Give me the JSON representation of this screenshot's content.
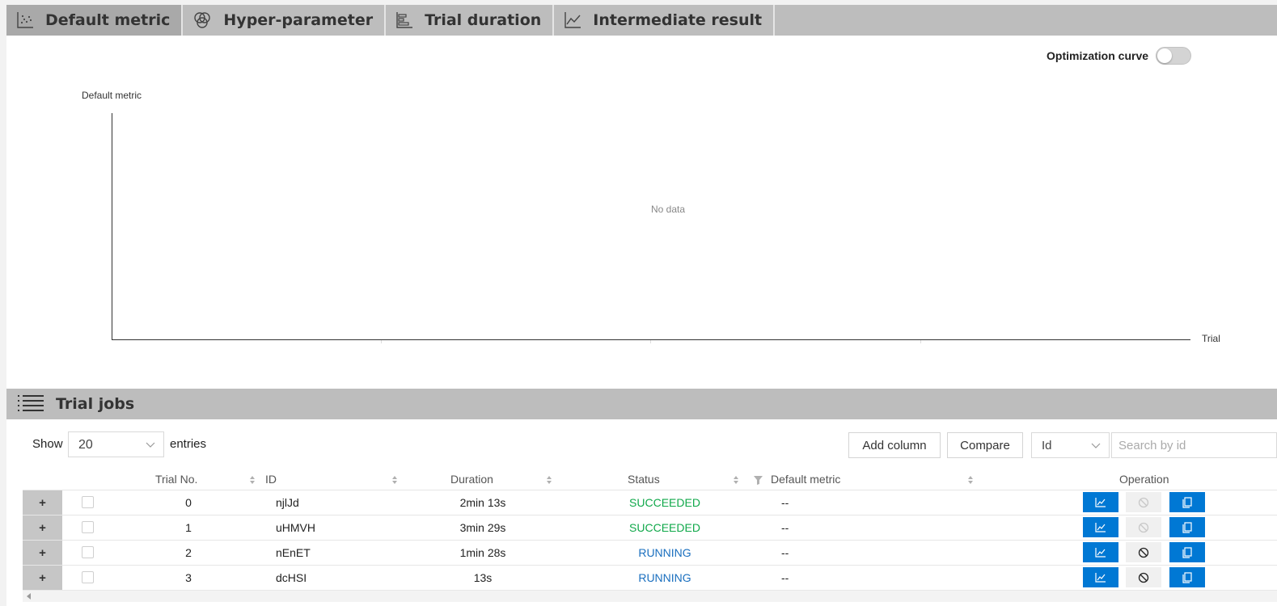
{
  "tabs": [
    {
      "label": "Default metric",
      "icon": "scatter-chart-icon",
      "active": true
    },
    {
      "label": "Hyper-parameter",
      "icon": "venn-diagram-icon",
      "active": false
    },
    {
      "label": "Trial duration",
      "icon": "bar-chart-icon",
      "active": false
    },
    {
      "label": "Intermediate result",
      "icon": "line-chart-icon",
      "active": false
    }
  ],
  "chart": {
    "optimization_curve_label": "Optimization curve",
    "optimization_curve_on": false,
    "ylabel": "Default metric",
    "xlabel": "Trial",
    "empty_text": "No data"
  },
  "chart_data": {
    "type": "scatter",
    "title": "",
    "xlabel": "Trial",
    "ylabel": "Default metric",
    "series": [],
    "note": "No data"
  },
  "jobs": {
    "title": "Trial jobs",
    "show_label": "Show",
    "entries_value": "20",
    "entries_label": "entries",
    "add_column_label": "Add column",
    "compare_label": "Compare",
    "search_field_value": "Id",
    "search_placeholder": "Search by id",
    "columns": {
      "trial_no": "Trial No.",
      "id": "ID",
      "duration": "Duration",
      "status": "Status",
      "default_metric": "Default metric",
      "operation": "Operation"
    },
    "expand_symbol": "+",
    "rows": [
      {
        "trial_no": "0",
        "id": "njlJd",
        "duration": "2min 13s",
        "status": "SUCCEEDED",
        "default_metric": "--",
        "kill_enabled": false
      },
      {
        "trial_no": "1",
        "id": "uHMVH",
        "duration": "3min 29s",
        "status": "SUCCEEDED",
        "default_metric": "--",
        "kill_enabled": false
      },
      {
        "trial_no": "2",
        "id": "nEnET",
        "duration": "1min 28s",
        "status": "RUNNING",
        "default_metric": "--",
        "kill_enabled": true
      },
      {
        "trial_no": "3",
        "id": "dcHSI",
        "duration": "13s",
        "status": "RUNNING",
        "default_metric": "--",
        "kill_enabled": true
      }
    ]
  },
  "colors": {
    "succeeded": "#10a84a",
    "running": "#1a6fbf",
    "operation_button": "#0078d4"
  }
}
